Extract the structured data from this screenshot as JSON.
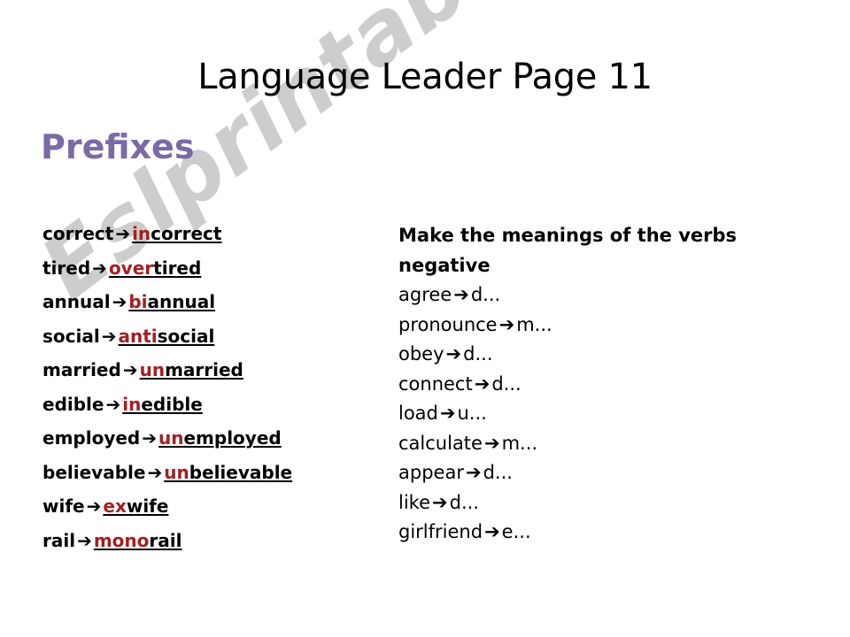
{
  "title": "Language Leader Page 11",
  "section_heading": "Prefixes",
  "watermark": "Eslprintables.com",
  "colors": {
    "prefix_red": "#a31f22",
    "heading_purple": "#7a6aa6",
    "text_black": "#000000",
    "watermark_gray": "#c9c9c9",
    "background": "#ffffff"
  },
  "arrow_glyph": "➔",
  "left_column": {
    "items": [
      {
        "base": "correct",
        "prefix": "in",
        "stem": "correct"
      },
      {
        "base": "tired",
        "prefix": "over",
        "stem": "tired"
      },
      {
        "base": "annual",
        "prefix": "bi",
        "stem": "annual"
      },
      {
        "base": "social",
        "prefix": "anti",
        "stem": "social"
      },
      {
        "base": "married",
        "prefix": "un",
        "stem": "married"
      },
      {
        "base": "edible",
        "prefix": "in",
        "stem": "edible"
      },
      {
        "base": "employed",
        "prefix": "un",
        "stem": "employed"
      },
      {
        "base": "believable",
        "prefix": "un",
        "stem": "believable"
      },
      {
        "base": "wife",
        "prefix": "ex",
        "stem": "wife"
      },
      {
        "base": "rail",
        "prefix": "mono",
        "stem": "rail"
      }
    ]
  },
  "right_column": {
    "heading": "Make the meanings of the verbs negative",
    "items": [
      {
        "base": "agree",
        "answer": "d..."
      },
      {
        "base": "pronounce",
        "answer": "m..."
      },
      {
        "base": "obey",
        "answer": "d..."
      },
      {
        "base": "connect",
        "answer": "d..."
      },
      {
        "base": "load",
        "answer": "u..."
      },
      {
        "base": "calculate",
        "answer": "m..."
      },
      {
        "base": "appear",
        "answer": "d..."
      },
      {
        "base": "like",
        "answer": "d..."
      },
      {
        "base": "girlfriend",
        "answer": "e..."
      }
    ]
  }
}
